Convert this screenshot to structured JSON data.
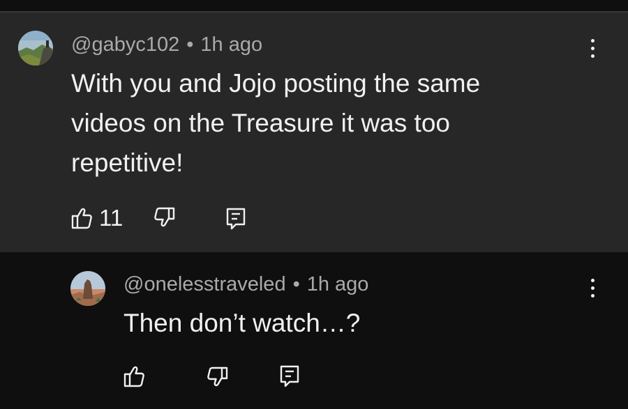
{
  "comments": [
    {
      "author": "@gabyc102",
      "separator": "•",
      "time": "1h ago",
      "text": "With you and Jojo posting the same\nvideos on the Treasure it was too\nrepetitive!",
      "like_count": "11",
      "avatar_icon": "landscape-avatar",
      "menu_icon": "more-vert-icon"
    },
    {
      "author": "@onelesstraveled",
      "separator": "•",
      "time": "1h ago",
      "text": "Then don’t watch…?",
      "like_count": "",
      "avatar_icon": "rock-formation-avatar",
      "menu_icon": "more-vert-icon"
    }
  ],
  "icons": {
    "like": "thumbs-up-icon",
    "dislike": "thumbs-down-icon",
    "reply": "reply-comment-icon"
  },
  "colors": {
    "highlight_bg": "#272727",
    "page_bg": "#0f0f0f",
    "secondary_text": "#aaaaaa",
    "primary_text": "#f1f1f1"
  }
}
